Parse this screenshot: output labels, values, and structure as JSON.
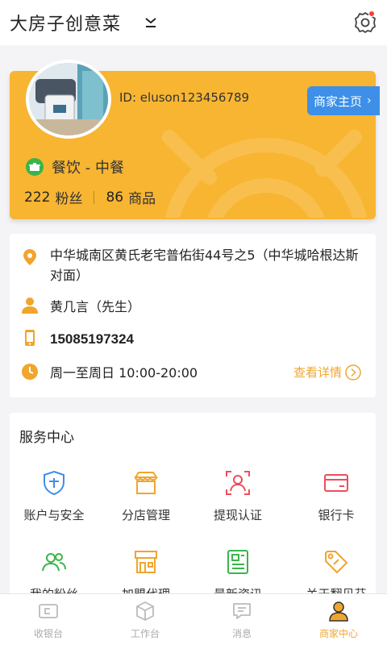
{
  "header": {
    "title": "大房子创意菜",
    "dropdown_icon": "chevron-down-icon",
    "settings_icon": "gear-icon"
  },
  "merchant": {
    "id_text": "ID: eluson123456789",
    "home_button": "商家主页",
    "category": "餐饮 - 中餐",
    "fans_count": "222",
    "fans_label": "粉丝",
    "products_count": "86",
    "products_label": "商品",
    "accent": "#f8b531"
  },
  "info": {
    "address": "中华城南区黄氏老宅普佑街44号之5（中华城哈根达斯对面）",
    "contact": "黄几言（先生）",
    "phone": "15085197324",
    "hours": "周一至周日  10:00-20:00",
    "detail_link": "查看详情"
  },
  "services": {
    "title": "服务中心",
    "items": [
      {
        "label": "账户与安全",
        "icon": "shield-icon",
        "color": "#3d8fe8"
      },
      {
        "label": "分店管理",
        "icon": "store-icon",
        "color": "#f0a52d"
      },
      {
        "label": "提现认证",
        "icon": "user-verify-icon",
        "color": "#ee4d5a"
      },
      {
        "label": "银行卡",
        "icon": "bank-card-icon",
        "color": "#ee4d5a"
      },
      {
        "label": "我的粉丝",
        "icon": "fans-icon",
        "color": "#3bb44a"
      },
      {
        "label": "加盟代理",
        "icon": "franchise-icon",
        "color": "#f0a52d"
      },
      {
        "label": "最新资讯",
        "icon": "news-icon",
        "color": "#3bb44a"
      },
      {
        "label": "关于翻贝芬",
        "icon": "tag-icon",
        "color": "#f0a52d"
      }
    ]
  },
  "nav": {
    "items": [
      {
        "label": "收银台",
        "icon": "cashier-icon"
      },
      {
        "label": "工作台",
        "icon": "workbench-icon"
      },
      {
        "label": "消息",
        "icon": "message-icon"
      },
      {
        "label": "商家中心",
        "icon": "merchant-center-icon"
      }
    ],
    "active_color": "#f0a52d"
  }
}
